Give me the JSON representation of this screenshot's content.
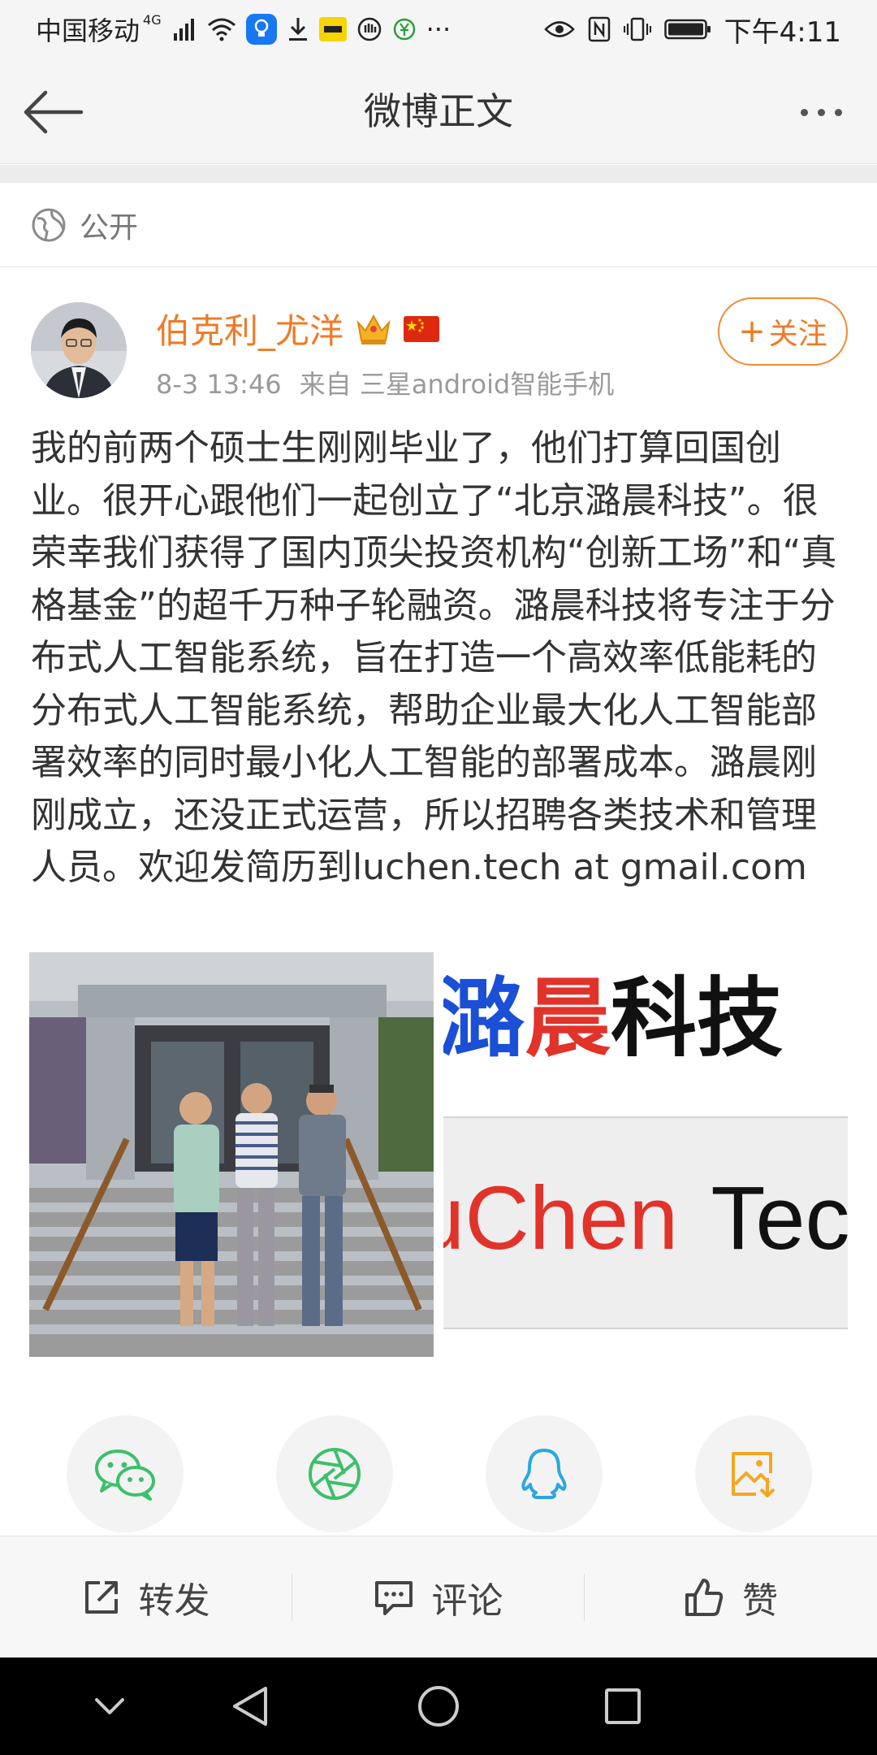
{
  "status_bar": {
    "carrier": "中国移动",
    "network": "4G",
    "time": "下午4:11",
    "overflow": "···"
  },
  "nav": {
    "title": "微博正文"
  },
  "post": {
    "visibility": "公开",
    "author": {
      "name": "伯克利_尤洋",
      "date": "8-3 13:46",
      "source": "来自 三星android智能手机",
      "follow_label": "关注",
      "follow_plus": "+"
    },
    "text": "我的前两个硕士生刚刚毕业了，他们打算回国创业。很开心跟他们一起创立了“北京潞晨科技”。很荣幸我们获得了国内顶尖投资机构“创新工场”和“真格基金”的超千万种子轮融资。潞晨科技将专注于分布式人工智能系统，旨在打造一个高效率低能耗的分布式人工智能系统，帮助企业最大化人工智能部署效率的同时最小化人工智能的部署成本。潞晨刚刚成立，还没正式运营，所以招聘各类技术和管理人员。欢迎发简历到luchen.tech at gmail.com",
    "logo_image": {
      "cn": [
        "潞",
        "晨",
        "科技"
      ],
      "en": [
        "Lu",
        "Chen",
        "Tech"
      ]
    }
  },
  "share_targets": [
    "wechat-icon",
    "moments-icon",
    "qq-icon",
    "save-image-icon"
  ],
  "actions": {
    "repost": "转发",
    "comment": "评论",
    "like": "赞"
  },
  "colors": {
    "accent_orange": "#f07a26",
    "wechat_green": "#3dbf6b",
    "qq_blue": "#2aa7e0",
    "save_orange": "#f5a623",
    "logo_blue": "#1a4fd6",
    "logo_red": "#e1332a"
  }
}
